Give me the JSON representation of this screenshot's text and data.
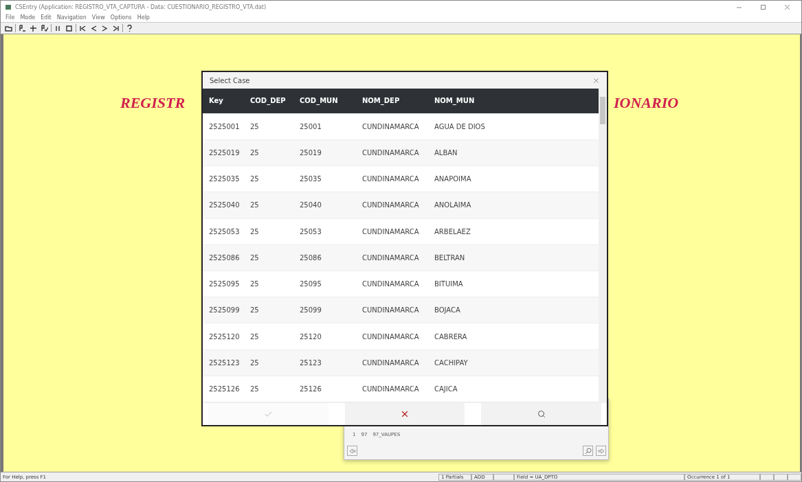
{
  "window": {
    "title": "CSEntry (Application: REGISTRO_VTA_CAPTURA - Data: CUESTIONARIO_REGISTRO_VTA.dat)"
  },
  "menu": [
    "File",
    "Mode",
    "Edit",
    "Navigation",
    "View",
    "Options",
    "Help"
  ],
  "form": {
    "title_left": "REGISTR",
    "title_right": "IONARIO",
    "back_list_row": [
      "1",
      "97",
      "97_VAUPES"
    ]
  },
  "dialog": {
    "title": "Select Case",
    "columns": [
      "Key",
      "COD_DEP",
      "COD_MUN",
      "NOM_DEP",
      "NOM_MUN"
    ],
    "rows": [
      [
        "2525001",
        "25",
        "25001",
        "CUNDINAMARCA",
        "AGUA DE DIOS"
      ],
      [
        "2525019",
        "25",
        "25019",
        "CUNDINAMARCA",
        "ALBAN"
      ],
      [
        "2525035",
        "25",
        "25035",
        "CUNDINAMARCA",
        "ANAPOIMA"
      ],
      [
        "2525040",
        "25",
        "25040",
        "CUNDINAMARCA",
        "ANOLAIMA"
      ],
      [
        "2525053",
        "25",
        "25053",
        "CUNDINAMARCA",
        "ARBELAEZ"
      ],
      [
        "2525086",
        "25",
        "25086",
        "CUNDINAMARCA",
        "BELTRAN"
      ],
      [
        "2525095",
        "25",
        "25095",
        "CUNDINAMARCA",
        "BITUIMA"
      ],
      [
        "2525099",
        "25",
        "25099",
        "CUNDINAMARCA",
        "BOJACA"
      ],
      [
        "2525120",
        "25",
        "25120",
        "CUNDINAMARCA",
        "CABRERA"
      ],
      [
        "2525123",
        "25",
        "25123",
        "CUNDINAMARCA",
        "CACHIPAY"
      ],
      [
        "2525126",
        "25",
        "25126",
        "CUNDINAMARCA",
        "CAJICA"
      ]
    ],
    "buttons": [
      {
        "kind": "ok",
        "disabled": true
      },
      {
        "kind": "cancel",
        "disabled": false
      },
      {
        "kind": "search",
        "disabled": false
      }
    ]
  },
  "status_bar": [
    "For Help, press F1",
    "1 Partials",
    "ADD",
    "Field = UA_DPTO",
    "Occurrence 1 of 1"
  ]
}
